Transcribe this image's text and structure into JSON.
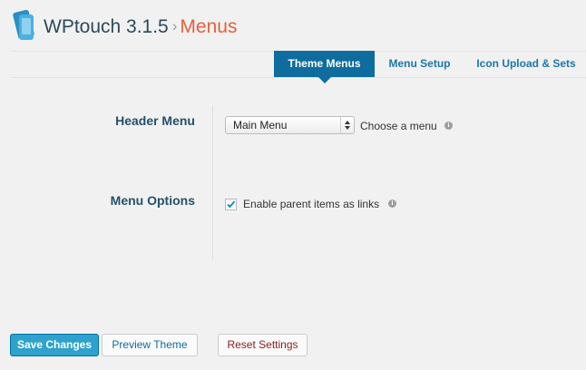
{
  "header": {
    "brand": "WPtouch 3.1.5",
    "separator": "›",
    "section": "Menus"
  },
  "tabs": [
    {
      "label": "Theme Menus",
      "active": true
    },
    {
      "label": "Menu Setup",
      "active": false
    },
    {
      "label": "Icon Upload & Sets",
      "active": false
    }
  ],
  "settings": {
    "header_menu": {
      "label": "Header Menu",
      "selected": "Main Menu",
      "hint": "Choose a menu"
    },
    "menu_options": {
      "label": "Menu Options",
      "checkbox_label": "Enable parent items as links",
      "checked": true
    }
  },
  "buttons": {
    "save": "Save Changes",
    "preview": "Preview Theme",
    "reset": "Reset Settings"
  },
  "icons": {
    "logo": "wptouch-logo-icon",
    "info": "info-icon",
    "check": "checkmark-icon",
    "select_arrows": "updown-arrows-icon"
  },
  "colors": {
    "accent": "#0e6d9e",
    "primary_button": "#2ea2cc",
    "section_title": "#e85f3c",
    "reset_text": "#8b1c1c"
  }
}
